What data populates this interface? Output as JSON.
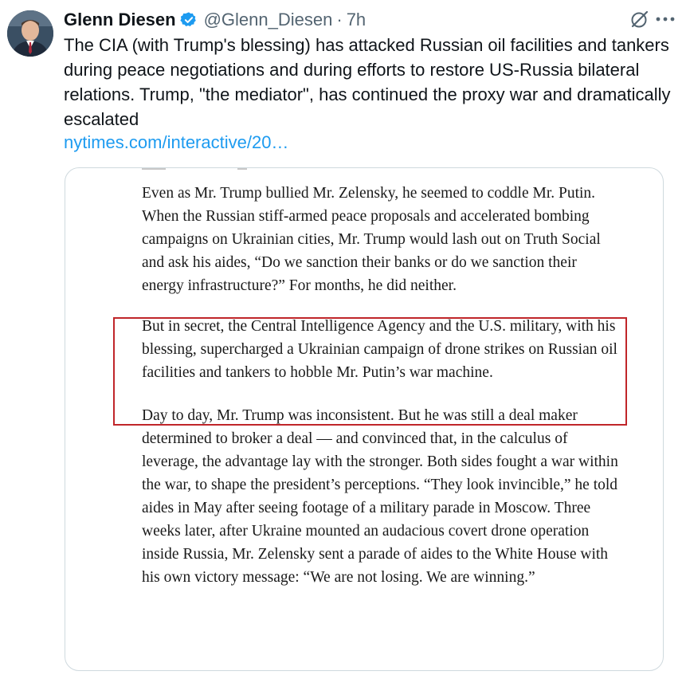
{
  "tweet": {
    "author": {
      "display_name": "Glenn Diesen",
      "handle": "@Glenn_Diesen",
      "verified": true,
      "avatar_icon": "profile-photo"
    },
    "separator": "·",
    "timestamp": "7h",
    "text": "The CIA (with Trump's blessing) has attacked Russian oil facilities and tankers during peace negotiations and during efforts to restore US-Russia bilateral relations. Trump, \"the mediator\", has continued the proxy war and dramatically escalated",
    "link": "nytimes.com/interactive/20…",
    "actions": {
      "grok_icon": "grok-icon",
      "more_icon": "more-icon"
    }
  },
  "media": {
    "paragraphs": [
      "Even as Mr. Trump bullied Mr. Zelensky, he seemed to coddle Mr. Putin. When the Russian stiff-armed peace proposals and accelerated bombing campaigns on Ukrainian cities, Mr. Trump would lash out on Truth Social and ask his aides, “Do we sanction their banks or do we sanction their energy infrastructure?” For months, he did neither.",
      "But in secret, the Central Intelligence Agency and the U.S. military, with his blessing, supercharged a Ukrainian campaign of drone strikes on Russian oil facilities and tankers to hobble Mr. Putin’s war machine.",
      "Day to day, Mr. Trump was inconsistent. But he was still a deal maker determined to broker a deal — and convinced that, in the calculus of leverage, the advantage lay with the stronger. Both sides fought a war within the war, to shape the president’s perceptions. “They look invincible,” he told aides in May after seeing footage of a military parade in Moscow. Three weeks later, after Ukraine mounted an audacious covert drone operation inside Russia, Mr. Zelensky sent a parade of aides to the White House with his own victory message: “We are not losing. We are winning.”"
    ],
    "highlight_color": "#c0262a"
  },
  "colors": {
    "link": "#1d9bf0",
    "verified_badge": "#1d9bf0",
    "secondary_text": "#536471",
    "card_border": "#cfd9de"
  }
}
